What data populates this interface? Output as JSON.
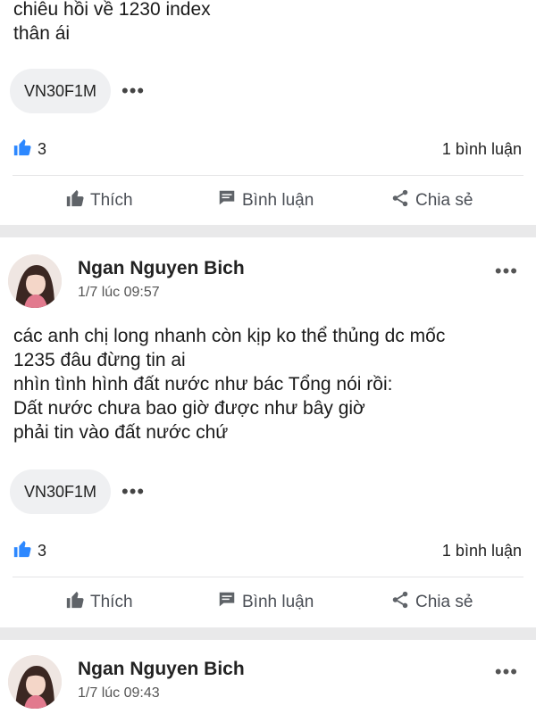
{
  "post1": {
    "body_lines": [
      "chiêu hồi về 1230 index",
      "thân ái"
    ],
    "tag": "VN30F1M",
    "tag_more": "•••",
    "like_count": "3",
    "comment_count": "1 bình luận",
    "actions": {
      "like": "Thích",
      "comment": "Bình luận",
      "share": "Chia sẻ"
    }
  },
  "post2": {
    "author": "Ngan Nguyen Bich",
    "time": "1/7 lúc 09:57",
    "menu": "•••",
    "body_lines": [
      "các anh chị long nhanh còn kịp ko thể thủng dc mốc",
      "1235 đâu đừng tin ai",
      "nhìn tình hình đất nước như bác Tổng nói rồi:",
      "Dất nước chưa bao giờ được như bây giờ",
      "phải tin vào đất nước chứ"
    ],
    "tag": "VN30F1M",
    "tag_more": "•••",
    "like_count": "3",
    "comment_count": "1 bình luận",
    "actions": {
      "like": "Thích",
      "comment": "Bình luận",
      "share": "Chia sẻ"
    }
  },
  "post3": {
    "author": "Ngan Nguyen Bich",
    "time": "1/7 lúc 09:43",
    "menu": "•••"
  },
  "colors": {
    "like_blue": "#2d88ff",
    "icon_gray": "#5f6368",
    "separator": "#e9e9ea"
  }
}
